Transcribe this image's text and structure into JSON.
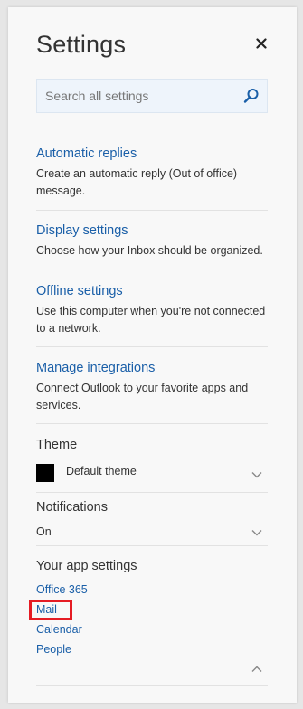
{
  "panel": {
    "title": "Settings",
    "close_icon": "close-icon"
  },
  "search": {
    "placeholder": "Search all settings",
    "value": "",
    "icon": "search-icon"
  },
  "sections": [
    {
      "title": "Automatic replies",
      "description": "Create an automatic reply (Out of office) message."
    },
    {
      "title": "Display settings",
      "description": "Choose how your Inbox should be organized."
    },
    {
      "title": "Offline settings",
      "description": "Use this computer when you're not connected to a network."
    },
    {
      "title": "Manage integrations",
      "description": "Connect Outlook to your favorite apps and services."
    }
  ],
  "theme": {
    "label": "Theme",
    "value": "Default theme",
    "swatch_color": "#000000"
  },
  "notifications": {
    "label": "Notifications",
    "value": "On"
  },
  "app_settings": {
    "label": "Your app settings",
    "links": [
      "Office 365",
      "Mail",
      "Calendar",
      "People"
    ],
    "highlighted": "Mail"
  },
  "colors": {
    "link": "#1a5fa8",
    "highlight": "#e51c24",
    "search_bg": "#eef4fb"
  }
}
